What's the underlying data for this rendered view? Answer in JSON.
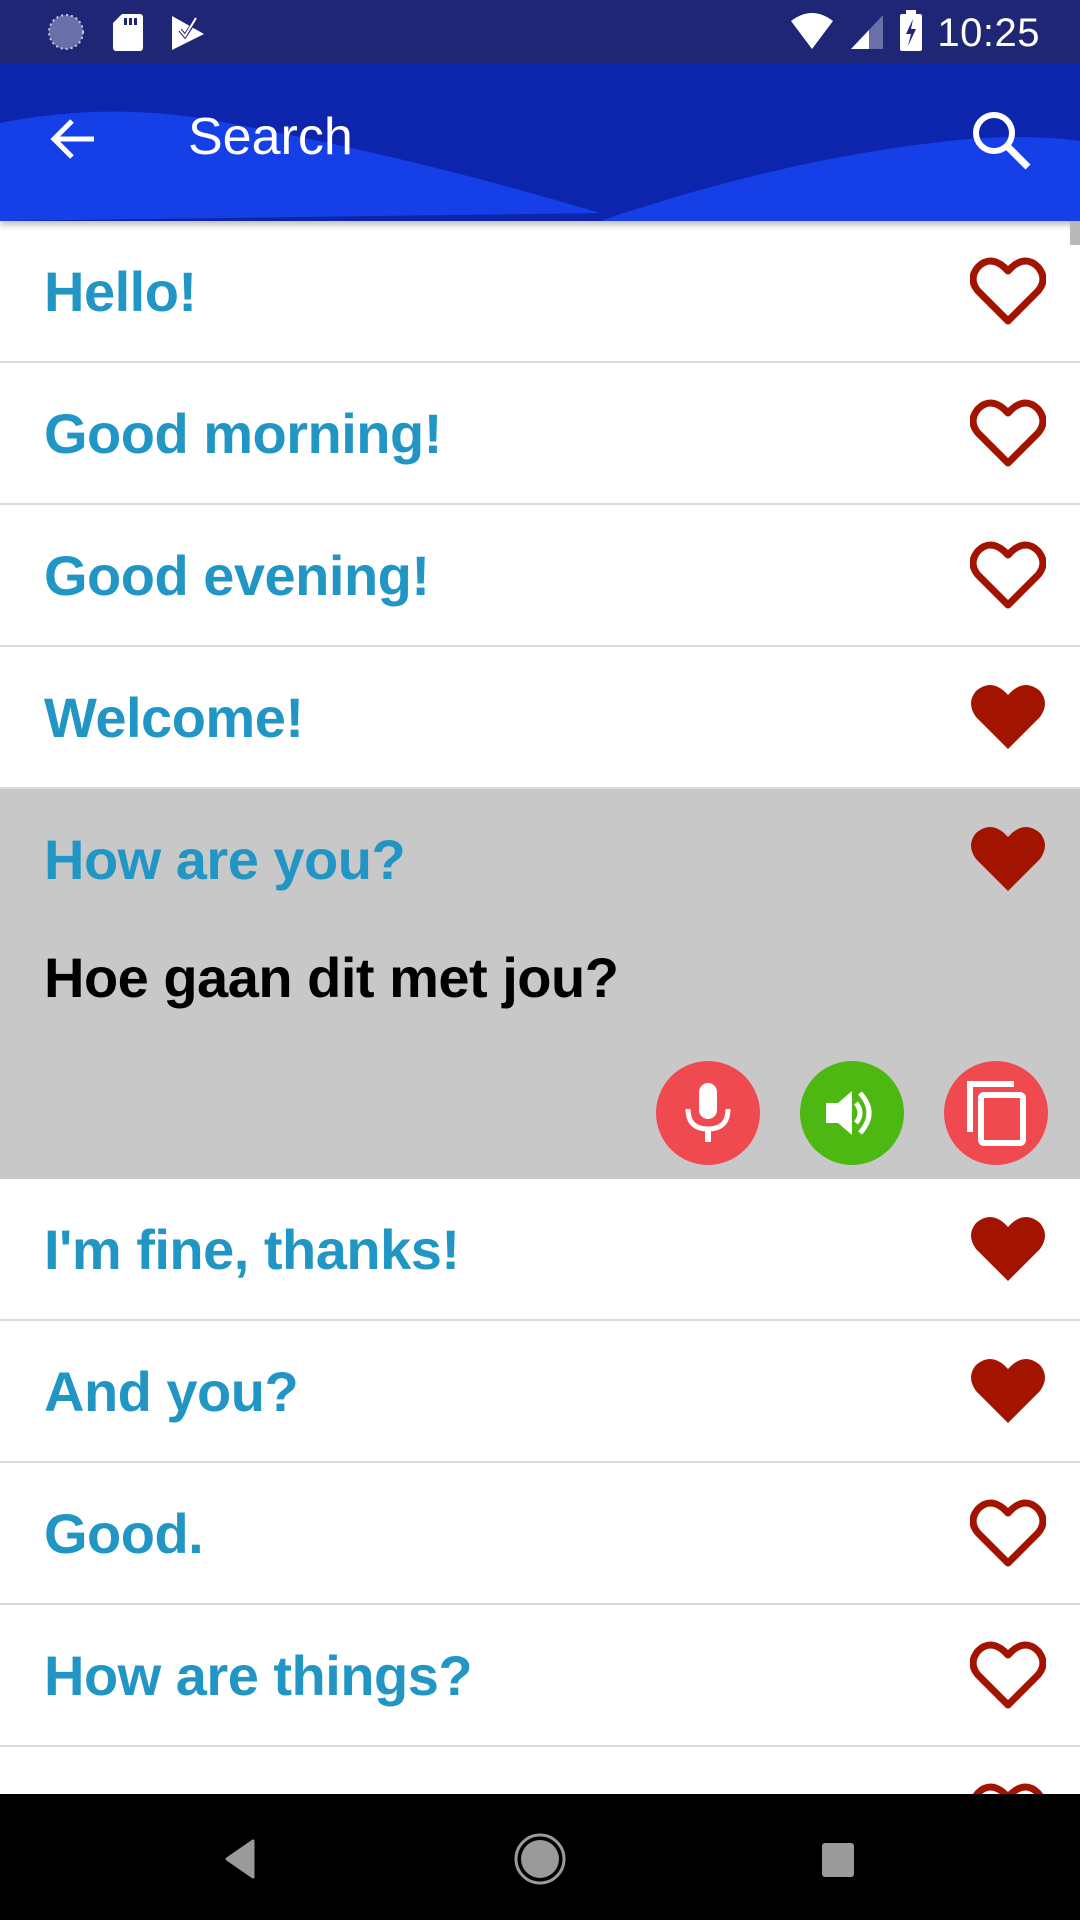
{
  "status_bar": {
    "time": "10:25",
    "left_icons": [
      "sync-icon",
      "sd-card-icon",
      "task-check-icon"
    ],
    "right_icons": [
      "wifi-icon",
      "cell-signal-icon",
      "battery-charging-icon"
    ]
  },
  "app_bar": {
    "title": "Search",
    "back_icon": "arrow-back-icon",
    "search_icon": "search-icon",
    "colors": {
      "dark": "#0d25ad",
      "light": "#1540e8"
    }
  },
  "phrases": [
    {
      "text": "Hello!",
      "favorite": false
    },
    {
      "text": "Good morning!",
      "favorite": false
    },
    {
      "text": "Good evening!",
      "favorite": false
    },
    {
      "text": "Welcome!",
      "favorite": true
    },
    {
      "text": "How are you?",
      "favorite": true,
      "expanded": true,
      "translation": "Hoe gaan dit met jou?"
    },
    {
      "text": "I'm fine, thanks!",
      "favorite": true
    },
    {
      "text": "And you?",
      "favorite": true
    },
    {
      "text": "Good.",
      "favorite": false
    },
    {
      "text": "How are things?",
      "favorite": false
    },
    {
      "text": "",
      "favorite": false
    }
  ],
  "expanded_actions": [
    {
      "name": "record-button",
      "icon": "microphone-icon",
      "color": "#ee4a4f"
    },
    {
      "name": "play-audio-button",
      "icon": "speaker-icon",
      "color": "#4cb811"
    },
    {
      "name": "copy-button",
      "icon": "copy-icon",
      "color": "#ee4a4f"
    }
  ],
  "colors": {
    "phrase_text": "#2196c4",
    "heart": "#a31400",
    "expanded_bg": "#c8c8c8"
  },
  "nav_bar": {
    "buttons": [
      "back-nav-icon",
      "home-nav-icon",
      "recents-nav-icon"
    ]
  }
}
